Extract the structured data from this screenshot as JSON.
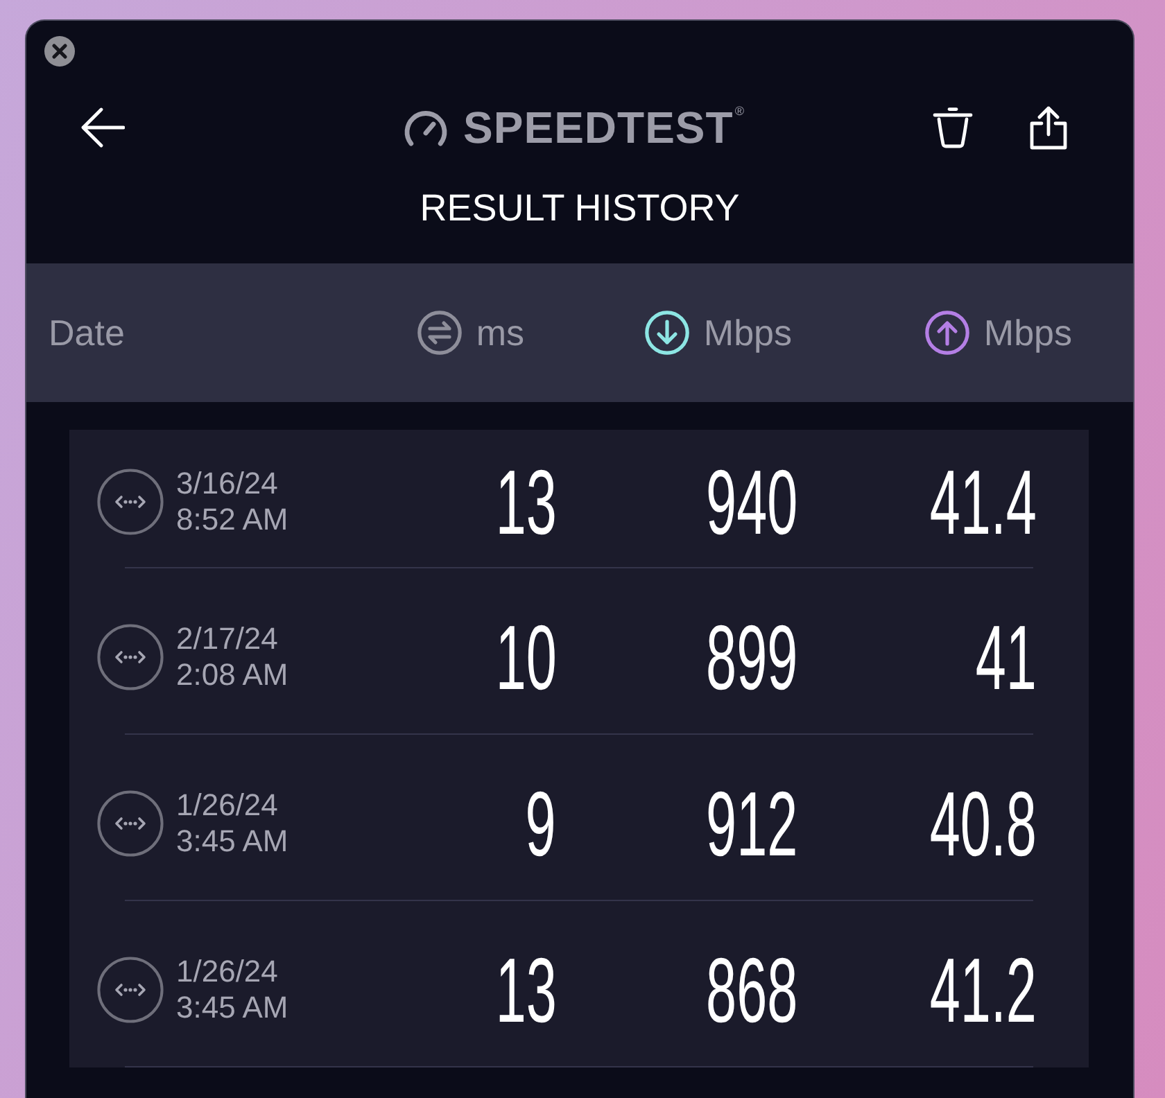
{
  "header": {
    "logo": "SPEEDTEST$^{®}$",
    "title": "RESULT HISTORY"
  },
  "columns": [
    {
      "kind": "date",
      "label": "Date"
    },
    {
      "kind": "ping",
      "label": "ms",
      "color": "#8e8e9a"
    },
    {
      "kind": "download",
      "label": "Mbps",
      "color": "#8de6e4"
    },
    {
      "kind": "upload",
      "label": "Mbps",
      "color": "#b47fe5"
    }
  ],
  "rows": [
    {
      "date": "3/16/24",
      "time": "8:52 AM",
      "ping": "13",
      "download": "940",
      "upload": "41.4"
    },
    {
      "date": "2/17/24",
      "time": "2:08 AM",
      "ping": "10",
      "download": "899",
      "upload": "41"
    },
    {
      "date": "1/26/24",
      "time": "3:45 AM",
      "ping": "9",
      "download": "912",
      "upload": "40.8"
    },
    {
      "date": "1/26/24",
      "time": "3:45 AM",
      "ping": "13",
      "download": "868",
      "upload": "41.2"
    }
  ]
}
